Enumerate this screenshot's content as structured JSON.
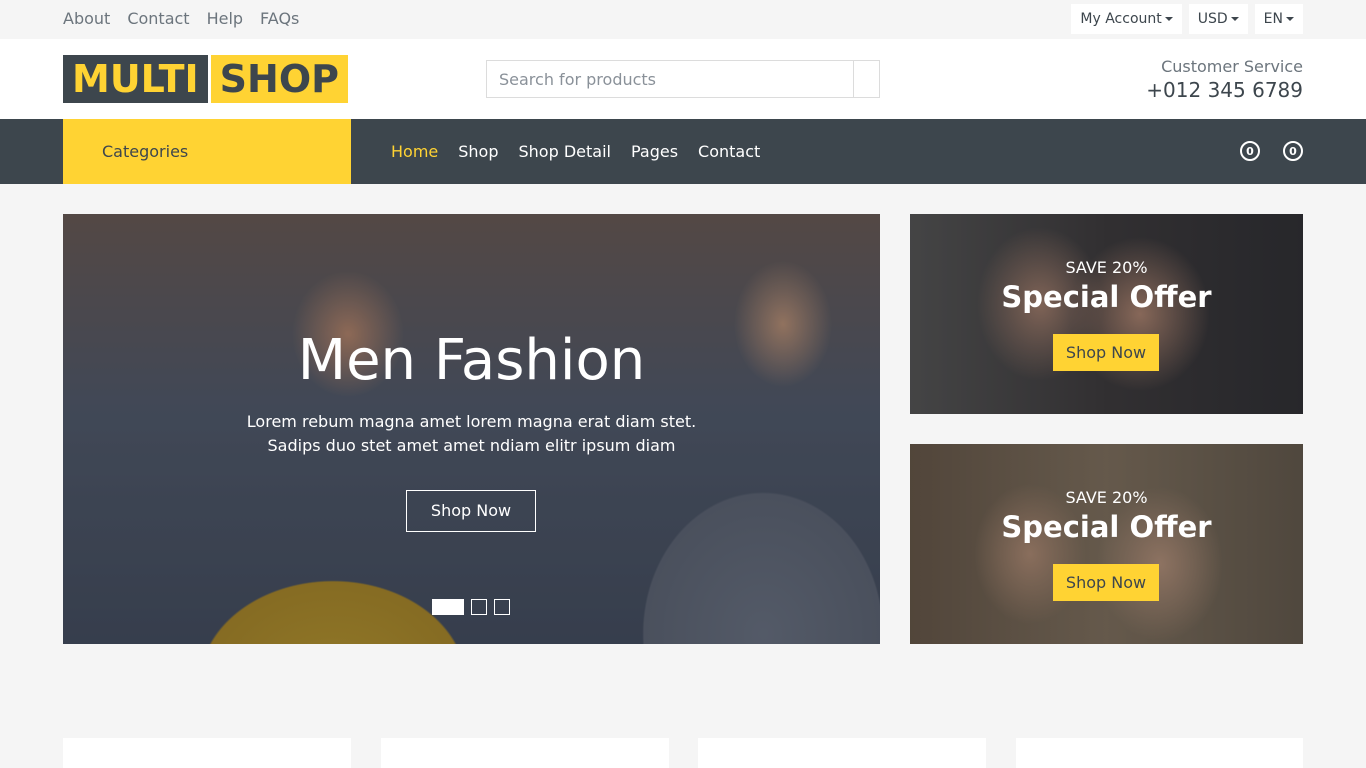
{
  "topbar": {
    "links": [
      "About",
      "Contact",
      "Help",
      "FAQs"
    ],
    "account_label": "My Account",
    "currency_label": "USD",
    "language_label": "EN"
  },
  "header": {
    "logo_part1": "MULTI",
    "logo_part2": "SHOP",
    "search_placeholder": "Search for products",
    "cs_label": "Customer Service",
    "cs_phone": "+012 345 6789"
  },
  "nav": {
    "categories_label": "Categories",
    "items": [
      "Home",
      "Shop",
      "Shop Detail",
      "Pages",
      "Contact"
    ],
    "active_item": "Home",
    "wishlist_count": "0",
    "cart_count": "0"
  },
  "hero": {
    "title": "Men Fashion",
    "desc_line1": "Lorem rebum magna amet lorem magna erat diam stet.",
    "desc_line2": "Sadips duo stet amet amet ndiam elitr ipsum diam",
    "button": "Shop Now",
    "slide_count": 3,
    "active_slide": 1
  },
  "offers": [
    {
      "save": "SAVE 20%",
      "title": "Special Offer",
      "button": "Shop Now"
    },
    {
      "save": "SAVE 20%",
      "title": "Special Offer",
      "button": "Shop Now"
    }
  ],
  "colors": {
    "accent": "#ffd333",
    "dark": "#3d464d",
    "background": "#f5f5f5"
  }
}
